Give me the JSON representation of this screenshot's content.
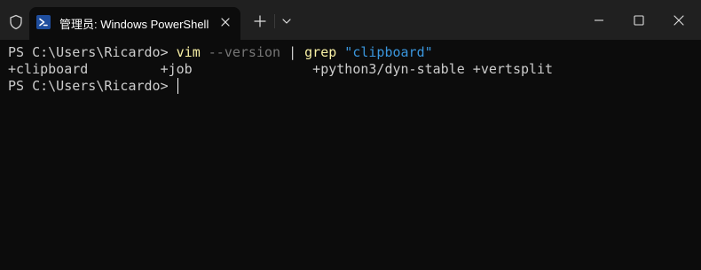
{
  "window": {
    "tab_title": "管理员: Windows PowerShell"
  },
  "icons": {
    "shield": "shield-icon",
    "powershell": "powershell-icon",
    "close_tab": "close-icon",
    "new_tab": "plus-icon",
    "dropdown": "chevron-down-icon",
    "minimize": "minimize-icon",
    "maximize": "maximize-icon",
    "close_window": "close-icon"
  },
  "terminal": {
    "line1": {
      "prompt": "PS C:\\Users\\Ricardo> ",
      "cmd1": "vim",
      "arg1": " --version",
      "pipe": " | ",
      "cmd2": "grep",
      "arg2": " \"clipboard\""
    },
    "line2": {
      "output": "+clipboard         +job               +python3/dyn-stable +vertsplit"
    },
    "line3": {
      "prompt": "PS C:\\Users\\Ricardo> "
    }
  },
  "colors": {
    "background": "#0c0c0c",
    "titlebar": "#202020",
    "text": "#cccccc",
    "command": "#f9f1a5",
    "parameter": "#767676",
    "string": "#3a96dd"
  }
}
